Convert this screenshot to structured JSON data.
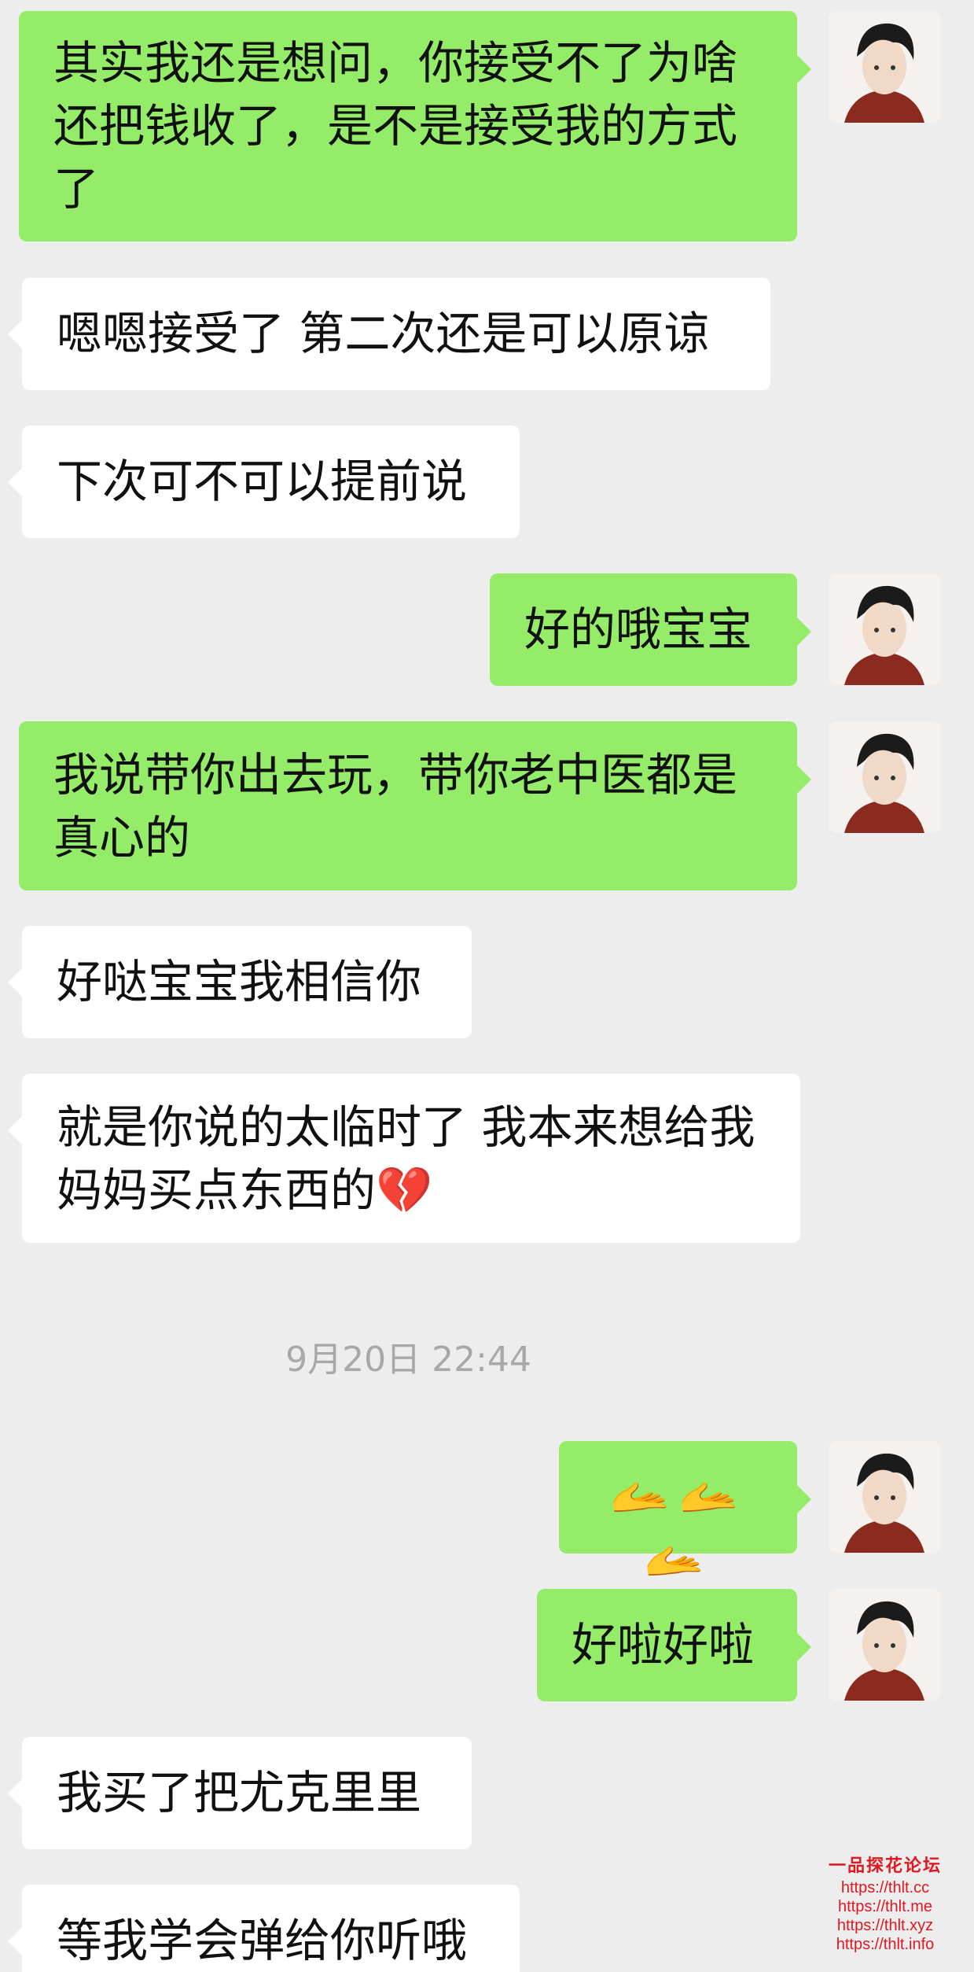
{
  "messages": [
    {
      "side": "out",
      "text": "其实我还是想问，你接受不了为啥还把钱收了，是不是接受我的方式了"
    },
    {
      "side": "in",
      "text": "嗯嗯接受了 第二次还是可以原谅"
    },
    {
      "side": "in",
      "text": "下次可不可以提前说"
    },
    {
      "side": "out",
      "text": "好的哦宝宝"
    },
    {
      "side": "out",
      "text": "我说带你出去玩，带你老中医都是真心的"
    },
    {
      "side": "in",
      "text": "好哒宝宝我相信你"
    },
    {
      "side": "in",
      "text": "就是你说的太临时了 我本来想给我妈妈买点东西的💔"
    },
    {
      "side": "out",
      "text": "🫴🫴🫴"
    },
    {
      "side": "out",
      "text": "好啦好啦"
    },
    {
      "side": "in",
      "text": "我买了把尤克里里"
    },
    {
      "side": "in",
      "text": "等我学会弹给你听哦"
    }
  ],
  "timestamp": "9月20日 22:44",
  "watermark": {
    "title": "一品探花论坛",
    "urls": [
      "https://thlt.cc",
      "https://thlt.me",
      "https://thlt.xyz",
      "https://thlt.info"
    ]
  },
  "colors": {
    "background": "#ededed",
    "outgoing": "#95ec69",
    "incoming": "#ffffff",
    "timestamp": "#a8a8a8",
    "watermark": "#e0181f"
  },
  "icons": {
    "avatar": "avatar-portrait-icon",
    "broken_heart": "broken-heart-emoji"
  }
}
